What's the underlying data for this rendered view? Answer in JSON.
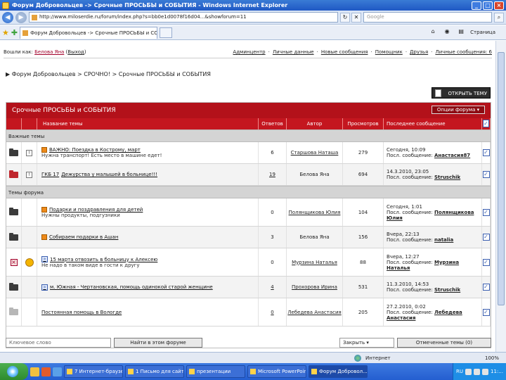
{
  "window": {
    "title": "Форум Добровольцев -> Срочные ПРОСЬБЫ и СОБЫТИЯ - Windows Internet Explorer",
    "url": "http://www.miloserdie.ru/forum/index.php?s=bb0e1d0078f16d04...&showforum=11",
    "search_placeholder": "Google",
    "tab_label": "Форум Добровольцев -> Срочные ПРОСЬБЫ и СОБ...",
    "page_menu": "Страница"
  },
  "userbar": {
    "login_prefix": "Вошли как:",
    "username": "Белова Яна",
    "logout": "Выход",
    "nav": [
      "Админцентр",
      "Личные данные",
      "Новые сообщения",
      "Помощник",
      "Друзья",
      "Личные сообщения: 6"
    ]
  },
  "breadcrumb": "Форум Добровольцев > СРОЧНО! > Срочные ПРОСЬБЫ и СОБЫТИЯ",
  "new_topic_button": "ОТКРЫТЬ ТЕМУ",
  "forum": {
    "title": "Срочные ПРОСЬБЫ и СОБЫТИЯ",
    "options_button": "Опции форума",
    "columns": {
      "topic": "Название темы",
      "replies": "Ответов",
      "author": "Автор",
      "views": "Просмотров",
      "last_post": "Последнее сообщение"
    },
    "sections": {
      "important": "Важные темы",
      "forum_topics": "Темы форума"
    },
    "important_topics": [
      {
        "title": "ВАЖНО: Поездка в Кострому, март",
        "desc": "Нужна транспорт! Есть место в машине едет!",
        "replies": "6",
        "author": "Старшова Наташа",
        "views": "279",
        "last_date": "Сегодня, 10:09",
        "last_label": "Посл. сообщение:",
        "last_user": "Анастасия87"
      },
      {
        "title": "Дежурства у малышей в больнице!!!",
        "prefix": "ГКБ 17",
        "desc": "",
        "replies": "19",
        "author": "Белова Яна",
        "views": "694",
        "last_date": "14.3.2010, 23:05",
        "last_label": "Посл. сообщение:",
        "last_user": "Struschik"
      }
    ],
    "topics": [
      {
        "title": "Подарки и поздравления для детей",
        "desc": "Нужны продукты, подгузники",
        "replies": "0",
        "author": "Полянщикова Юлия",
        "views": "104",
        "last_date": "Сегодня, 1:01",
        "last_label": "Посл. сообщение:",
        "last_user": "Полянщикова Юлия"
      },
      {
        "title": "Собираем подарки в Ашан",
        "desc": "",
        "replies": "3",
        "author": "Белова Яна",
        "views": "156",
        "last_date": "Вчера, 22:13",
        "last_label": "Посл. сообщение:",
        "last_user": "natalia"
      },
      {
        "title": "15 марта отвозить в больницу к Алексею",
        "desc": "Не надо в таком виде в гости к другу",
        "replies": "0",
        "author": "Мурзина Наталья",
        "views": "88",
        "last_date": "Вчера, 12:27",
        "last_label": "Посл. сообщение:",
        "last_user": "Мурзина Наталья"
      },
      {
        "title": "м. Южная - Чертановская, помощь одинокой старой женщине",
        "desc": "",
        "replies": "4",
        "author": "Прохорова Ирина",
        "views": "531",
        "last_date": "11.3.2010, 14:53",
        "last_label": "Посл. сообщение:",
        "last_user": "Struschik"
      },
      {
        "title": "Постоянная помощь в Вологде",
        "desc": "",
        "replies": "0",
        "author": "Лебедева Анастасия",
        "views": "205",
        "last_date": "27.2.2010, 0:02",
        "last_label": "Посл. сообщение:",
        "last_user": "Лебедева Анастасия"
      }
    ]
  },
  "bottom": {
    "search_placeholder": "Ключевое слово",
    "search_button": "Найти в этом форуме",
    "action_select": "Закрыть",
    "action_button": "Отмеченные темы (0)"
  },
  "status": {
    "zone": "Интернет",
    "zoom": "100%"
  },
  "taskbar": {
    "tasks": [
      "7 Интернет-браузер",
      "1 Письмо для сайт...",
      "презентации",
      "Microsoft PowerPoint",
      "Форум Добровол..."
    ],
    "lang": "RU",
    "time": "11:..."
  }
}
